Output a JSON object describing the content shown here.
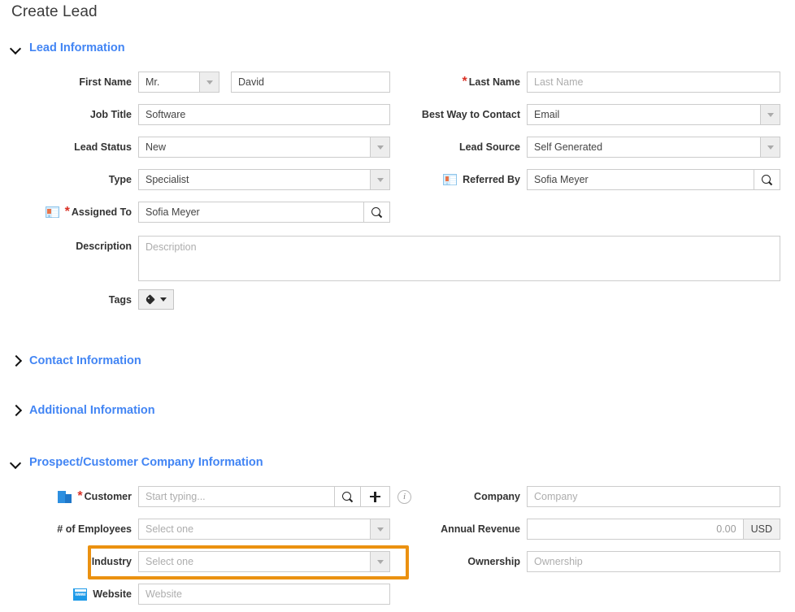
{
  "page": {
    "title": "Create Lead"
  },
  "sections": [
    {
      "title": "Lead Information",
      "expanded": true
    },
    {
      "title": "Contact Information",
      "expanded": false
    },
    {
      "title": "Additional Information",
      "expanded": false
    },
    {
      "title": "Prospect/Customer Company Information",
      "expanded": true
    }
  ],
  "lead_information": {
    "first_name": {
      "label": "First Name",
      "salutation_value": "Mr.",
      "name_value": "David"
    },
    "job_title": {
      "label": "Job Title",
      "value": "Software"
    },
    "lead_status": {
      "label": "Lead Status",
      "value": "New"
    },
    "type": {
      "label": "Type",
      "value": "Specialist"
    },
    "assigned_to": {
      "label": "Assigned To",
      "value": "Sofia Meyer",
      "required": "*",
      "icon": "contact-card-icon"
    },
    "description": {
      "label": "Description",
      "placeholder": "Description"
    },
    "tags": {
      "label": "Tags",
      "icon": "tag-icon"
    },
    "last_name": {
      "label": "Last Name",
      "placeholder": "Last Name",
      "required": "*"
    },
    "best_way_to_contact": {
      "label": "Best Way to Contact",
      "value": "Email"
    },
    "lead_source": {
      "label": "Lead Source",
      "value": "Self Generated"
    },
    "referred_by": {
      "label": "Referred By",
      "value": "Sofia Meyer",
      "icon": "contact-card-icon"
    }
  },
  "company_information": {
    "customer": {
      "label": "Customer",
      "required": "*",
      "placeholder": "Start typing...",
      "icon": "building-icon",
      "search_icon": "search-icon",
      "add_icon": "plus-icon",
      "info_icon": "info-icon",
      "info_glyph": "i"
    },
    "employees": {
      "label": "# of Employees",
      "placeholder": "Select one"
    },
    "industry": {
      "label": "Industry",
      "placeholder": "Select one",
      "highlighted": true
    },
    "website": {
      "label": "Website",
      "placeholder": "Website",
      "icon": "www-icon"
    },
    "company": {
      "label": "Company",
      "placeholder": "Company"
    },
    "annual_revenue": {
      "label": "Annual Revenue",
      "value": "0.00",
      "currency": "USD"
    },
    "ownership": {
      "label": "Ownership",
      "placeholder": "Ownership"
    }
  },
  "colors": {
    "section_title": "#4285f4",
    "required_marker": "#d93025",
    "highlight_border": "#eb9110",
    "field_border": "#cccccc",
    "placeholder": "#adadad"
  }
}
